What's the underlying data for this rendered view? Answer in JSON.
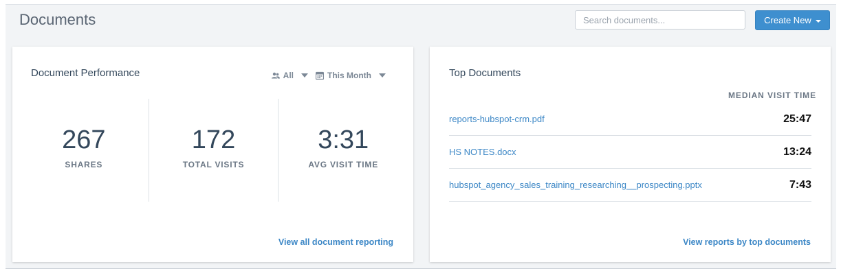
{
  "header": {
    "title": "Documents",
    "search_placeholder": "Search documents...",
    "create_label": "Create New"
  },
  "performance": {
    "title": "Document Performance",
    "filter_people": "All",
    "filter_period": "This Month",
    "stats": [
      {
        "value": "267",
        "label": "SHARES"
      },
      {
        "value": "172",
        "label": "TOTAL VISITS"
      },
      {
        "value": "3:31",
        "label": "AVG VISIT TIME"
      }
    ],
    "link": "View all document reporting"
  },
  "top_documents": {
    "title": "Top Documents",
    "column_header": "MEDIAN VISIT TIME",
    "rows": [
      {
        "name": "reports-hubspot-crm.pdf",
        "time": "25:47"
      },
      {
        "name": "HS NOTES.docx",
        "time": "13:24"
      },
      {
        "name": "hubspot_agency_sales_training_researching__prospecting.pptx",
        "time": "7:43"
      }
    ],
    "link": "View reports by top documents"
  },
  "colors": {
    "accent": "#3e8fcf",
    "link": "#3c87c6",
    "text_dark": "#33475b",
    "background": "#f2f4f6"
  },
  "icons": [
    "people-icon",
    "calendar-icon",
    "caret-down-icon"
  ]
}
